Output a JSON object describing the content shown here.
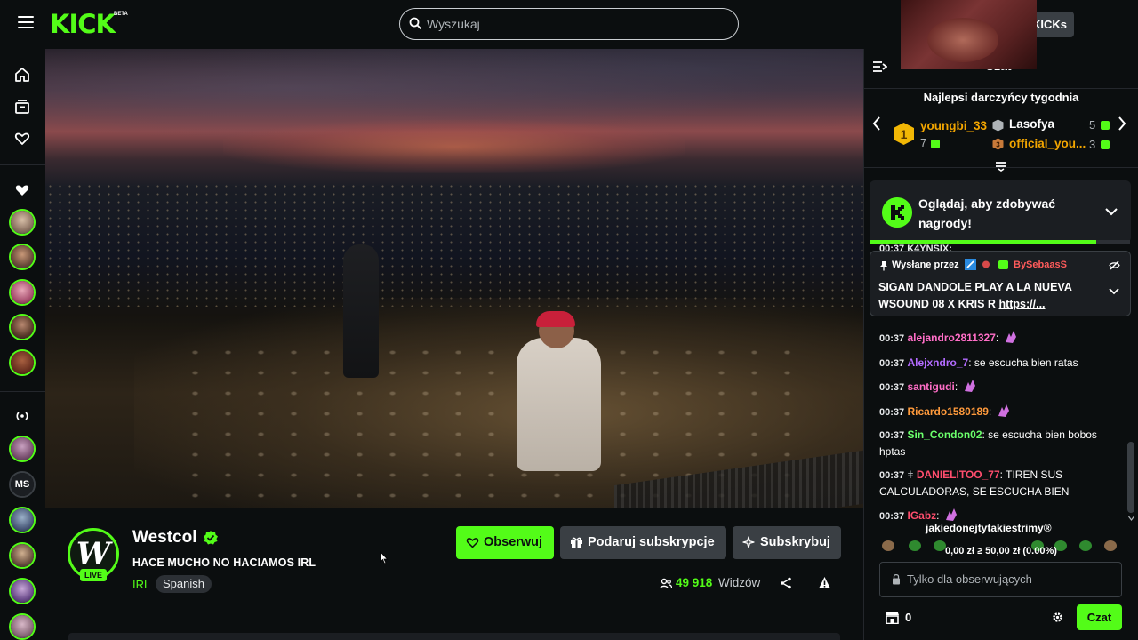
{
  "header": {
    "logo": "KICK",
    "logo_badge": "BETA",
    "search_placeholder": "Wyszukaj",
    "kicks_label": "KICKs"
  },
  "sidebar": {
    "followed_avatars": 5,
    "live_avatars": [
      {
        "type": "image"
      },
      {
        "type": "text",
        "label": "MS"
      },
      {
        "type": "image"
      },
      {
        "type": "image"
      },
      {
        "type": "image"
      },
      {
        "type": "image"
      }
    ]
  },
  "channel": {
    "name": "Westcol",
    "live_badge": "LIVE",
    "stream_title": "HACE MUCHO NO HACIAMOS IRL",
    "category": "IRL",
    "language": "Spanish",
    "follow_label": "Obserwuj",
    "gift_sub_label": "Podaruj subskrypcje",
    "subscribe_label": "Subskrybuj",
    "viewers": "49 918",
    "viewers_label": "Widzów"
  },
  "chat": {
    "title": "Czat",
    "top_gifters_title": "Najlepsi darczyńcy tygodnia",
    "gifters": [
      {
        "rank": "1",
        "name": "youngbi_33",
        "count": "7"
      },
      {
        "name": "Lasofya",
        "count": "5"
      },
      {
        "rank": "3",
        "name": "official_you...",
        "count": "3"
      }
    ],
    "rewards_text": "Oglądaj, aby zdobywać nagrody!",
    "rewards_progress": 0.87,
    "cut_line": "00:37 K4YNSIX:",
    "pinned": {
      "by_label": "Wysłane przez",
      "user": "BySebaasS",
      "message": "SIGAN DANDOLE PLAY A LA NUEVA WSOUND 08 X KRIS R",
      "link": "https://..."
    },
    "messages": [
      {
        "time": "00:37",
        "user": "alejandro2811327",
        "color": "#ff6ec7",
        "text": "",
        "emote": true
      },
      {
        "time": "00:37",
        "user": "Alejxndro_7",
        "color": "#b36bff",
        "text": "se escucha bien ratas",
        "emote": false
      },
      {
        "time": "00:37",
        "user": "santigudi",
        "color": "#ff6ec7",
        "text": "",
        "emote": true
      },
      {
        "time": "00:37",
        "user": "Ricardo1580189",
        "color": "#ff9a3c",
        "text": "",
        "emote": true
      },
      {
        "time": "00:37",
        "user": "Sin_Condon02",
        "color": "#6bff6b",
        "text": "se escucha bien bobos hptas",
        "emote": false
      },
      {
        "time": "00:37",
        "user": "DANIELITOO_77",
        "color": "#ff4d6d",
        "text": "TIREN SUS CALCULADORAS, SE ESCUCHA BIEN",
        "emote": false
      },
      {
        "time": "00:37",
        "user": "IGabz",
        "color": "#ff4d6d",
        "text": "",
        "emote": true
      }
    ],
    "sub_goal": {
      "title": "jakiedonejtytakiestrimy®",
      "progress_text": "0,00 zł ≥ 50,00 zł (0.00%)"
    },
    "input_placeholder": "Tylko dla obserwujących",
    "points": "0",
    "send_label": "Czat"
  },
  "colors": {
    "accent": "#53fc18",
    "background": "#0b0e0f",
    "button_secondary": "#3a3f44"
  }
}
